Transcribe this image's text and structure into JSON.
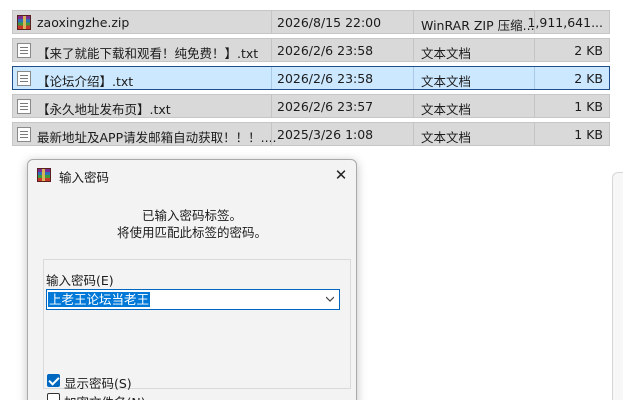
{
  "files": [
    {
      "name": "zaoxingzhe.zip",
      "date": "2026/8/15 22:00",
      "type": "WinRAR ZIP 压缩...",
      "size": "1,911,641...",
      "icon": "winrar-zip-icon",
      "selected": false
    },
    {
      "name": "【来了就能下载和观看！纯免费！】.txt",
      "date": "2026/2/6 23:58",
      "type": "文本文档",
      "size": "2 KB",
      "icon": "text-file-icon",
      "selected": false
    },
    {
      "name": "【论坛介绍】.txt",
      "date": "2026/2/6 23:58",
      "type": "文本文档",
      "size": "2 KB",
      "icon": "text-file-icon",
      "selected": true
    },
    {
      "name": "【永久地址发布页】.txt",
      "date": "2026/2/6 23:57",
      "type": "文本文档",
      "size": "1 KB",
      "icon": "text-file-icon",
      "selected": false
    },
    {
      "name": "最新地址及APP请发邮箱自动获取！！！....",
      "date": "2025/3/26 1:08",
      "type": "文本文档",
      "size": "1 KB",
      "icon": "text-file-icon",
      "selected": false
    }
  ],
  "dialog": {
    "title": "输入密码",
    "close_glyph": "✕",
    "message_line1": "已输入密码标签。",
    "message_line2": "将使用匹配此标签的密码。",
    "password_label": "输入密码(E)",
    "password_value": "上老王论坛当老王",
    "show_password_label": "显示密码(S)",
    "show_password_checked": true,
    "encrypt_names_label": "加密文件名(N)",
    "encrypt_names_checked": false
  },
  "colors": {
    "selected_row_bg": "#cce8ff",
    "selected_row_border": "#1f4f8a",
    "accent": "#0067c0",
    "row_bg": "#d9d9d9"
  }
}
